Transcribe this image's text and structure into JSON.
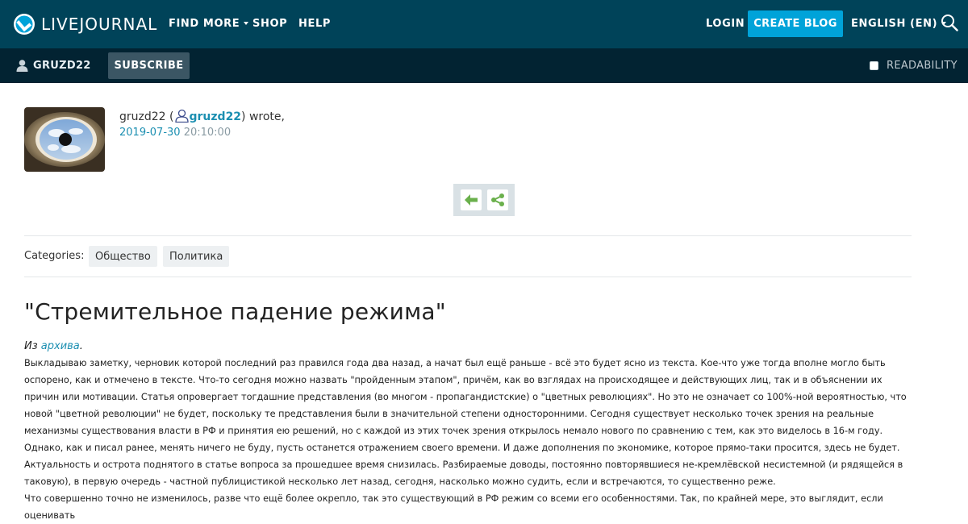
{
  "topbar": {
    "logo_text": "LIVEJOURNAL",
    "nav": {
      "find_more": "FIND MORE",
      "shop": "SHOP",
      "help": "HELP",
      "login": "LOGIN",
      "create_blog": "CREATE BLOG",
      "language": "ENGLISH (EN)"
    },
    "icons": {
      "search": "search-icon",
      "logo": "livejournal-logo-icon"
    },
    "colors": {
      "background": "#004359",
      "accent": "#00a3d9"
    }
  },
  "subbar": {
    "journal_name": "GRUZD22",
    "subscribe": "SUBSCRIBE",
    "readability": "READABILITY",
    "readability_checked": false
  },
  "post": {
    "author_display": "gruzd22",
    "author_username": "gruzd22",
    "wrote": "wrote,",
    "date": "2019-07-30",
    "time": "20:10:00",
    "categories_label": "Categories:",
    "categories": [
      "Общество",
      "Политика"
    ],
    "title": "\"Стремительное падение режима\"",
    "intro_prefix": "Из",
    "intro_link": "архива",
    "intro_suffix": ".",
    "paragraphs": [
      "Выкладываю заметку, черновик которой последний раз правился года два назад, а начат был ещё раньше - всё это будет ясно из текста. Кое-что уже тогда вполне могло быть оспорено, как и отмечено в тексте. Что-то сегодня можно назвать \"пройденным этапом\", причём, как во взглядах на происходящее и действующих лиц, так и в объяснении их причин или мотивации. Статья опровергает тогдашние представления (во многом - пропагандистские) о \"цветных революциях\". Но это не означает со 100%-ной вероятностью, что новой \"цветной революции\" не будет, поскольку те представления были в значительной степени односторонними. Сегодня существует несколько точек зрения на реальные механизмы существования власти в РФ и принятия ею решений, но с каждой из этих точек зрения открылось немало нового по сравнению с тем, как это виделось в 16-м году. Однако, как и писал ранее, менять ничего не буду, пусть останется отражением своего времени. И даже дополнения по экономике, которое прямо-таки просится, здесь не будет.",
      "Актуальность и острота поднятого в статье вопроса за прошедшее время снизилась. Разбираемые доводы, постоянно повторявшиеся не-кремлёвской несистемной (и рядящейся в таковую), в первую очередь - частной публицистикой несколько лет назад, сегодня, насколько можно судить, если и встречаются, то существенно реже.",
      "Что совершенно точно не изменилось, разве что ещё более окрепло, так это существующий в РФ режим со всеми его особенностями. Так, по крайней мере, это выглядит, если оценивать"
    ],
    "action_icons": [
      "back-arrow-icon",
      "share-icon"
    ]
  }
}
